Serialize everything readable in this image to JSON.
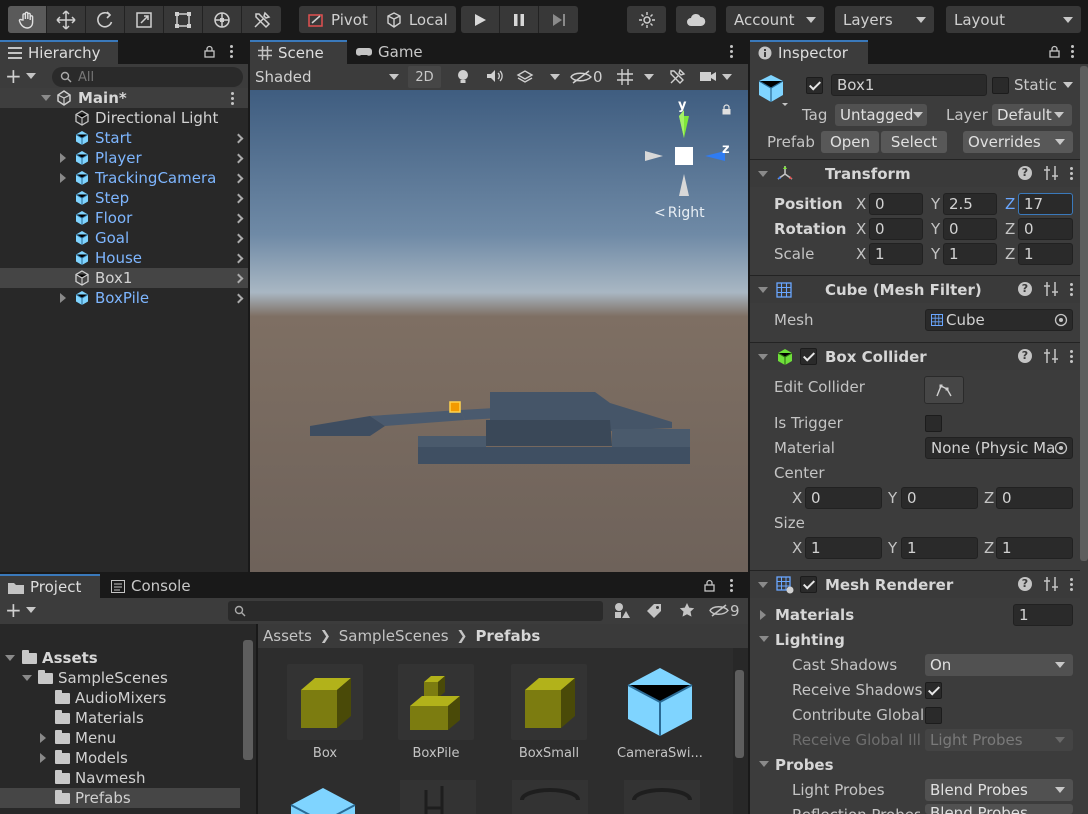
{
  "toolbar": {
    "pivot_label": "Pivot",
    "local_label": "Local",
    "account_label": "Account",
    "layers_label": "Layers",
    "layout_label": "Layout"
  },
  "hierarchy": {
    "tab_label": "Hierarchy",
    "search_placeholder": "All",
    "scene_name": "Main*",
    "items": [
      {
        "label": "Directional Light"
      },
      {
        "label": "Start"
      },
      {
        "label": "Player"
      },
      {
        "label": "TrackingCamera"
      },
      {
        "label": "Step"
      },
      {
        "label": "Floor"
      },
      {
        "label": "Goal"
      },
      {
        "label": "House"
      },
      {
        "label": "Box1"
      },
      {
        "label": "BoxPile"
      }
    ]
  },
  "scene": {
    "tab_scene": "Scene",
    "tab_game": "Game",
    "shading_mode": "Shaded",
    "mode_2d": "2D",
    "hidden_count": "0",
    "gizmo_y": "y",
    "gizmo_z": "z",
    "gizmo_view_label": "Right"
  },
  "inspector": {
    "tab_label": "Inspector",
    "object_name": "Box1",
    "static_label": "Static",
    "tag_label": "Tag",
    "tag_value": "Untagged",
    "layer_label": "Layer",
    "layer_value": "Default",
    "prefab_label": "Prefab",
    "open_label": "Open",
    "select_label": "Select",
    "overrides_label": "Overrides",
    "transform": {
      "title": "Transform",
      "position_label": "Position",
      "rotation_label": "Rotation",
      "scale_label": "Scale",
      "axis_x": "X",
      "axis_y": "Y",
      "axis_z": "Z",
      "position": {
        "x": "0",
        "y": "2.5",
        "z": "17"
      },
      "rotation": {
        "x": "0",
        "y": "0",
        "z": "0"
      },
      "scale": {
        "x": "1",
        "y": "1",
        "z": "1"
      }
    },
    "mesh_filter": {
      "title": "Cube (Mesh Filter)",
      "mesh_label": "Mesh",
      "mesh_value": "Cube"
    },
    "box_collider": {
      "title": "Box Collider",
      "edit_collider_label": "Edit Collider",
      "is_trigger_label": "Is Trigger",
      "material_label": "Material",
      "material_value": "None (Physic Ma",
      "center_label": "Center",
      "size_label": "Size",
      "center": {
        "x": "0",
        "y": "0",
        "z": "0"
      },
      "size": {
        "x": "1",
        "y": "1",
        "z": "1"
      }
    },
    "mesh_renderer": {
      "title": "Mesh Renderer",
      "materials_label": "Materials",
      "materials_count": "1",
      "lighting_label": "Lighting",
      "cast_shadows_label": "Cast Shadows",
      "cast_shadows_value": "On",
      "receive_shadows_label": "Receive Shadows",
      "contribute_global_label": "Contribute Global",
      "receive_global_label": "Receive Global Illu",
      "receive_global_value": "Light Probes",
      "probes_label": "Probes",
      "light_probes_label": "Light Probes",
      "light_probes_value": "Blend Probes",
      "reflection_probes_label": "Reflection Probes",
      "reflection_probes_value": "Blend Probes"
    }
  },
  "project": {
    "tab_project": "Project",
    "tab_console": "Console",
    "hidden_count": "9",
    "tree": [
      {
        "label": "Assets"
      },
      {
        "label": "SampleScenes"
      },
      {
        "label": "AudioMixers"
      },
      {
        "label": "Materials"
      },
      {
        "label": "Menu"
      },
      {
        "label": "Models"
      },
      {
        "label": "Navmesh"
      },
      {
        "label": "Prefabs"
      }
    ],
    "breadcrumb": [
      "Assets",
      "SampleScenes",
      "Prefabs"
    ],
    "assets": [
      {
        "name": "Box"
      },
      {
        "name": "BoxPile"
      },
      {
        "name": "BoxSmall"
      },
      {
        "name": "CameraSwi..."
      }
    ]
  },
  "colors": {
    "accent_blue": "#3a79bb",
    "hierarchy_prefab_text": "#7eb6ff",
    "prefab_cube": "#7fd4ff",
    "asset_box_yellow": "#8a8a10"
  }
}
